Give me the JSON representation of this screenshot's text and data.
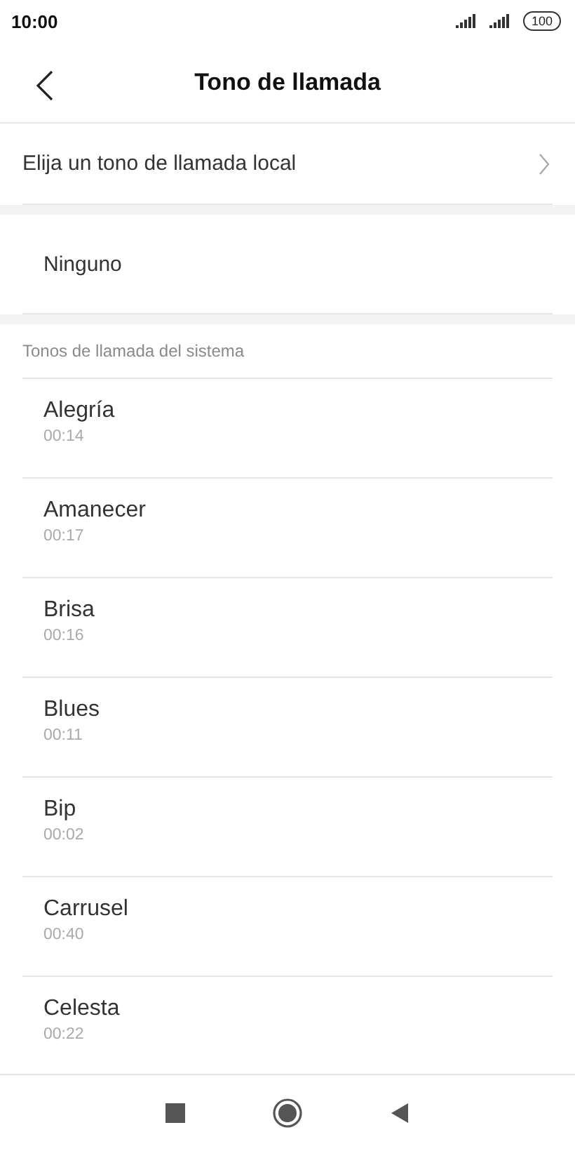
{
  "status_bar": {
    "time": "10:00",
    "battery": "100"
  },
  "header": {
    "title": "Tono de llamada"
  },
  "local_option": {
    "label": "Elija un tono de llamada local"
  },
  "none_option": {
    "label": "Ninguno"
  },
  "section": {
    "title": "Tonos de llamada del sistema"
  },
  "ringtones": [
    {
      "name": "Alegría",
      "duration": "00:14"
    },
    {
      "name": "Amanecer",
      "duration": "00:17"
    },
    {
      "name": "Brisa",
      "duration": "00:16"
    },
    {
      "name": "Blues",
      "duration": "00:11"
    },
    {
      "name": "Bip",
      "duration": "00:02"
    },
    {
      "name": "Carrusel",
      "duration": "00:40"
    },
    {
      "name": "Celesta",
      "duration": "00:22"
    }
  ]
}
